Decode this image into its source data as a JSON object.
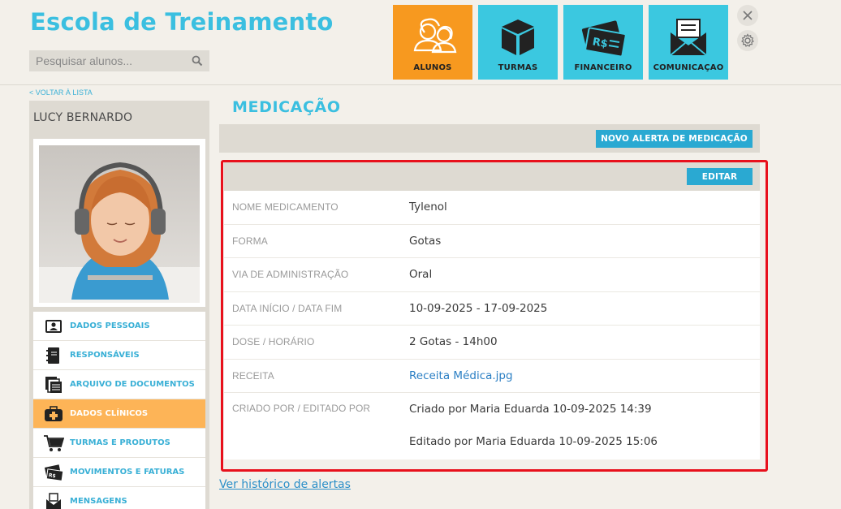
{
  "header": {
    "app_title": "Escola de Treinamento",
    "search_placeholder": "Pesquisar alunos..."
  },
  "nav": {
    "tiles": [
      {
        "label": "ALUNOS",
        "icon": "students-icon",
        "active": true
      },
      {
        "label": "TURMAS",
        "icon": "box-icon",
        "active": false
      },
      {
        "label": "FINANCEIRO",
        "icon": "money-icon",
        "active": false
      },
      {
        "label": "COMUNICAÇAO",
        "icon": "mail-icon",
        "active": false
      }
    ]
  },
  "back_link": "< VOLTAR À LISTA",
  "student": {
    "name": "LUCY BERNARDO"
  },
  "sidebar": {
    "items": [
      {
        "label": "DADOS PESSOAIS",
        "icon": "id-card-icon",
        "active": false
      },
      {
        "label": "RESPONSÁVEIS",
        "icon": "address-book-icon",
        "active": false
      },
      {
        "label": "ARQUIVO DE DOCUMENTOS",
        "icon": "documents-icon",
        "active": false
      },
      {
        "label": "DADOS CLÍNICOS",
        "icon": "medical-kit-icon",
        "active": true
      },
      {
        "label": "TURMAS E PRODUTOS",
        "icon": "cart-icon",
        "active": false
      },
      {
        "label": "MOVIMENTOS E FATURAS",
        "icon": "money-icon",
        "active": false
      },
      {
        "label": "MENSAGENS",
        "icon": "mail-icon",
        "active": false
      }
    ]
  },
  "main": {
    "title": "MEDICAÇÃO",
    "new_alert_button": "NOVO ALERTA DE MEDICAÇÃO",
    "edit_button": "EDITAR",
    "fields": [
      {
        "label": "NOME MEDICAMENTO",
        "value": "Tylenol"
      },
      {
        "label": "FORMA",
        "value": "Gotas"
      },
      {
        "label": "VIA DE ADMINISTRAÇÃO",
        "value": "Oral"
      },
      {
        "label": "DATA INÍCIO / DATA FIM",
        "value": "10-09-2025 - 17-09-2025"
      },
      {
        "label": "DOSE / HORÁRIO",
        "value": "2 Gotas - 14h00"
      },
      {
        "label": "RECEITA",
        "value": "Receita Médica.jpg"
      },
      {
        "label": "CRIADO POR / EDITADO POR",
        "value": "Criado por Maria Eduarda 10-09-2025 14:39",
        "value2": "Editado por Maria Eduarda 10-09-2025 15:06"
      }
    ],
    "history_link": "Ver histórico de alertas"
  },
  "colors": {
    "accent": "#3bbfe0",
    "active_tile": "#f7991f",
    "active_menu": "#fdb457",
    "button": "#2aa9d2",
    "highlight_border": "#e8101c"
  }
}
